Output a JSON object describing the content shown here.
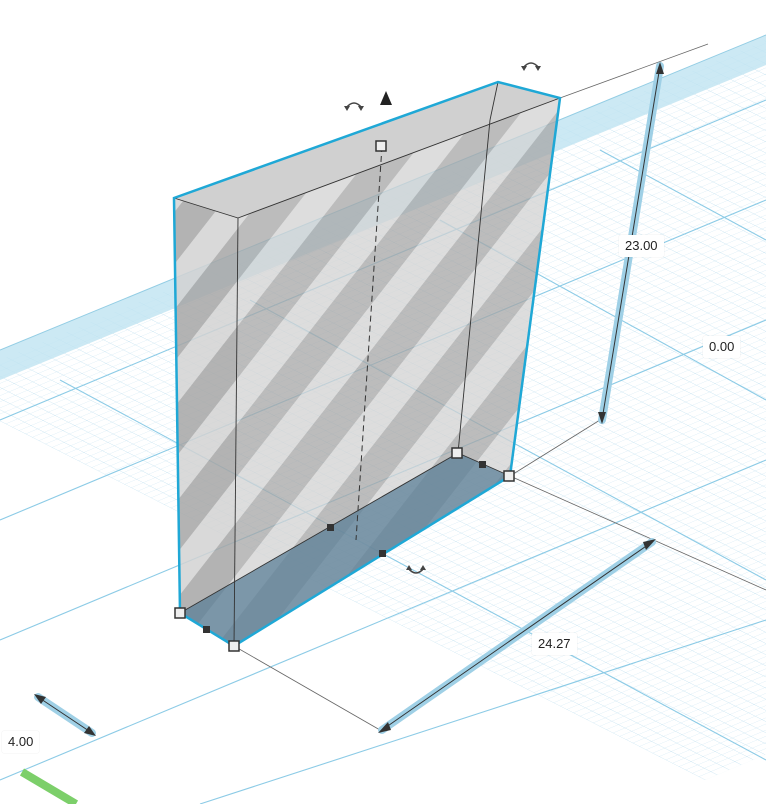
{
  "workplane": {
    "grid_color": "#a8d6ea",
    "major_grid_color": "#7fc2e0",
    "background": "#ffffff"
  },
  "shape": {
    "fill_color": "#9a9a9a",
    "outline_color": "#1fa8d6",
    "stripe_color": "#ffffff"
  },
  "dimensions": {
    "height": "23.00",
    "elevation": "0.00",
    "length": "24.27",
    "width": "4.00"
  },
  "icons": {
    "rotate_top_left": "rotate-arrow-icon",
    "rotate_top_right": "rotate-arrow-icon",
    "rotate_bottom": "rotate-arrow-icon",
    "lift": "lift-cone-icon"
  }
}
